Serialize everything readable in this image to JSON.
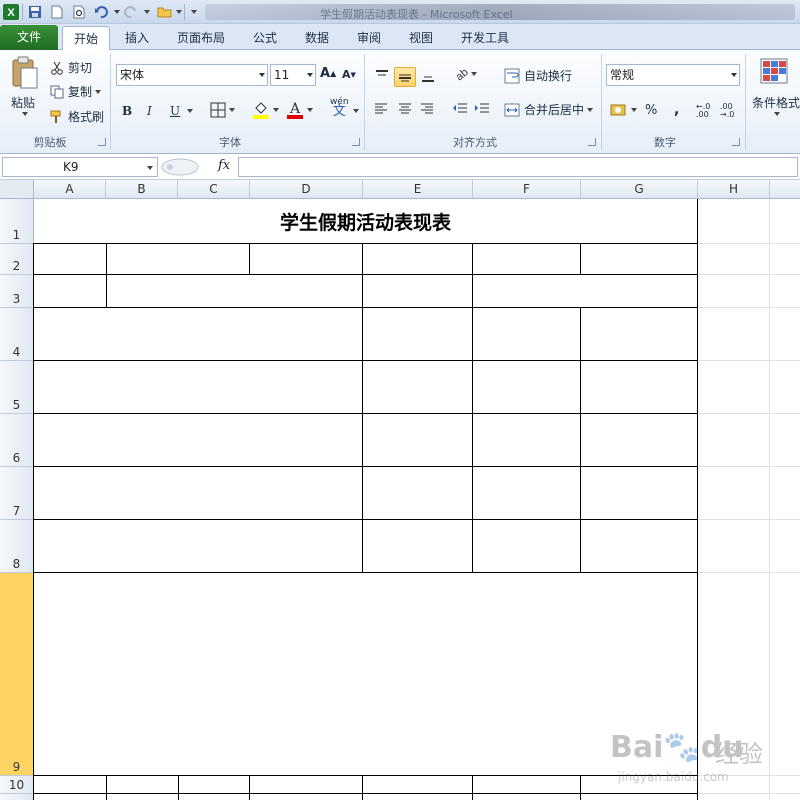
{
  "window": {
    "title": "学生假期活动表现表 - Microsoft Excel"
  },
  "tabs": [
    "文件",
    "开始",
    "插入",
    "页面布局",
    "公式",
    "数据",
    "审阅",
    "视图",
    "开发工具"
  ],
  "ribbon": {
    "clipboard": {
      "paste": "粘贴",
      "cut": "剪切",
      "copy": "复制",
      "format_painter": "格式刷",
      "label": "剪贴板"
    },
    "font": {
      "name": "宋体",
      "size": "11",
      "bold": "B",
      "italic": "I",
      "underline": "U",
      "wen": "wén",
      "wen_char": "文",
      "label": "字体"
    },
    "alignment": {
      "wrap": "自动换行",
      "merge": "合并后居中",
      "label": "对齐方式"
    },
    "number": {
      "format": "常规",
      "percent": "%",
      "comma": ",",
      "inc": "←.0 .00",
      "dec": ".00 →.0",
      "label": "数字"
    },
    "styles": {
      "conditional": "条件格式"
    }
  },
  "formula": {
    "namebox": "K9",
    "fx": "fx",
    "content": ""
  },
  "columns": [
    "A",
    "B",
    "C",
    "D",
    "E",
    "F",
    "G",
    "H"
  ],
  "rows": [
    "1",
    "2",
    "3",
    "4",
    "5",
    "6",
    "7",
    "8",
    "9",
    "10"
  ],
  "sheet": {
    "title": "学生假期活动表现表"
  },
  "watermark": {
    "brand": "Bai",
    "brand2": "du",
    "cn": "经验",
    "sub": "jingyan.baidu.com"
  },
  "colors": {
    "file_tab": "#2a7d2e",
    "selected_row": "#ffd462",
    "accent": "#ffd46a"
  }
}
